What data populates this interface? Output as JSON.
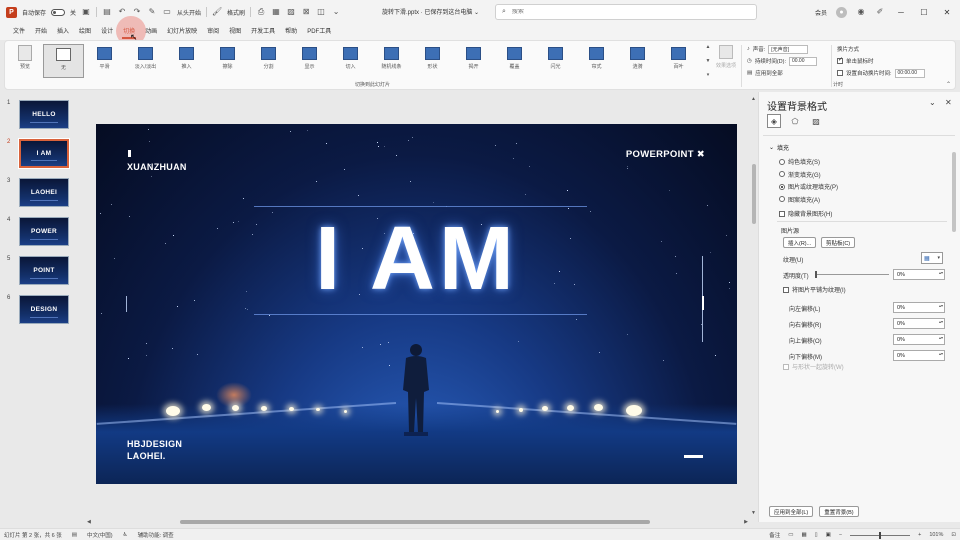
{
  "titlebar": {
    "autosave_label": "自动保存",
    "autosave_state": "关",
    "slideshow_label": "从头开始",
    "format_painter_label": "格式刷",
    "doc_title": "旋转下滑.pptx · 已保存到这台电脑 ⌄",
    "search_placeholder": "搜索",
    "user_name": "会员",
    "share_label": "共享",
    "comment_label": "批注"
  },
  "menu": {
    "tabs": [
      "文件",
      "开始",
      "插入",
      "绘图",
      "设计",
      "切换",
      "动画",
      "幻灯片放映",
      "审阅",
      "视图",
      "开发工具",
      "帮助",
      "PDF工具"
    ],
    "active_index": 5
  },
  "ribbon": {
    "preview_label": "预览",
    "transitions": [
      "无",
      "平滑",
      "淡入/淡出",
      "推入",
      "擦除",
      "分割",
      "显示",
      "切入",
      "随机线条",
      "形状",
      "揭开",
      "覆盖",
      "闪光",
      "帘式",
      "涟漪",
      "百叶"
    ],
    "selected_index": 0,
    "effect_options_label": "效果选项",
    "group_label": "切换到此幻灯片",
    "sound_label": "声音:",
    "sound_value": "[无声音]",
    "duration_label": "持续时间(D):",
    "duration_value": "00.00",
    "apply_all_label": "应用到全部",
    "advance_label": "换片方式",
    "on_click_label": "单击鼠标时",
    "after_label": "设置自动换片时间:",
    "after_value": "00:00.00",
    "timing_group_label": "计时"
  },
  "thumbnails": [
    {
      "num": "1",
      "label": "HELLO"
    },
    {
      "num": "2",
      "label": "I AM"
    },
    {
      "num": "3",
      "label": "LAOHEI"
    },
    {
      "num": "4",
      "label": "POWER"
    },
    {
      "num": "5",
      "label": "POINT"
    },
    {
      "num": "6",
      "label": "DESIGN"
    }
  ],
  "active_slide_index": 1,
  "slide": {
    "top_left": "XUANZHUAN",
    "top_right": "POWERPOINT ✖",
    "title": "I AM",
    "bottom_left_1": "HBJDESIGN",
    "bottom_left_2": "LAOHEI."
  },
  "pane": {
    "title": "设置背景格式",
    "section": "填充",
    "fill_options": [
      "纯色填充(S)",
      "渐变填充(G)",
      "图片或纹理填充(P)",
      "图案填充(A)"
    ],
    "fill_selected_index": 2,
    "hide_bg_label": "隐藏背景图形(H)",
    "picture_source_label": "图片源",
    "insert_button": "插入(R)...",
    "clipboard_button": "剪贴板(C)",
    "texture_label": "纹理(U)",
    "transparency_label": "透明度(T)",
    "transparency_value": "0%",
    "tile_label": "将图片平铺为纹理(I)",
    "offsets": [
      {
        "label": "向左偏移(L)",
        "value": "0%"
      },
      {
        "label": "向右偏移(R)",
        "value": "0%"
      },
      {
        "label": "向上偏移(O)",
        "value": "0%"
      },
      {
        "label": "向下偏移(M)",
        "value": "0%"
      }
    ],
    "rotate_label": "与形状一起旋转(W)",
    "apply_all_button": "应用到全部(L)",
    "reset_button": "重置背景(B)"
  },
  "statusbar": {
    "slide_info": "幻灯片 第 2 张，共 6 张",
    "language": "中文(中国)",
    "accessibility": "辅助功能: 调查",
    "notes_label": "备注",
    "zoom": "101%"
  },
  "colors": {
    "accent": "#c43e1c",
    "slide_dark": "#050c22",
    "slide_blue": "#2c66c8"
  }
}
